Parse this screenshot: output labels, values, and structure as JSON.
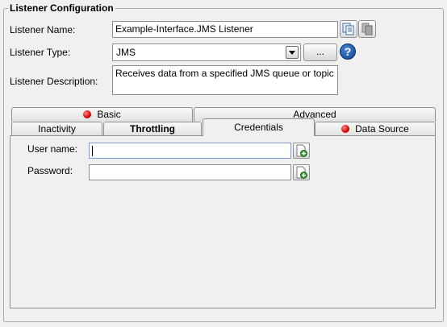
{
  "section": {
    "title": "Listener Configuration"
  },
  "fields": {
    "name_label": "Listener Name:",
    "name_value": "Example-Interface.JMS Listener",
    "type_label": "Listener Type:",
    "type_value": "JMS",
    "type_button": "...",
    "help_glyph": "?",
    "desc_label": "Listener Description:",
    "desc_value": "Receives data from a specified JMS queue or topic"
  },
  "tabs": {
    "row_back": [
      {
        "label": "Basic",
        "status": "error"
      },
      {
        "label": "Advanced"
      }
    ],
    "row_front": [
      {
        "label": "Inactivity"
      },
      {
        "label": "Throttling"
      },
      {
        "label": "Credentials",
        "active": true
      },
      {
        "label": "Data Source",
        "status": "error"
      }
    ]
  },
  "credentials": {
    "username_label": "User name:",
    "username_value": "",
    "password_label": "Password:",
    "password_value": ""
  },
  "colors": {
    "error_dot": "#d40000",
    "help_icon": "#1a4fa0",
    "add_icon": "#2e9a2e"
  }
}
